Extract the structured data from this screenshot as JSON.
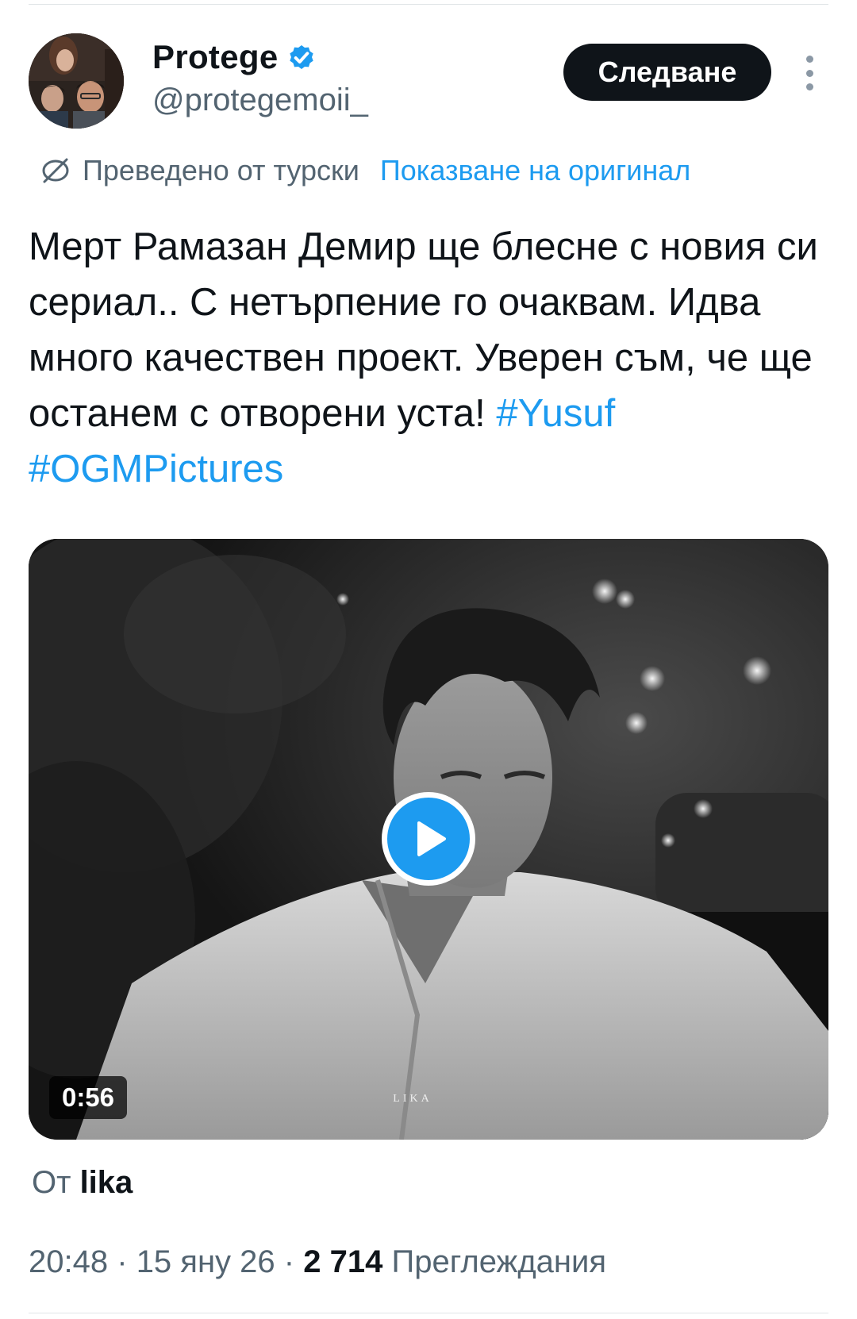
{
  "author": {
    "display_name": "Protege",
    "handle": "@protegemoii_",
    "verified": true,
    "follow_label": "Следване"
  },
  "translation": {
    "label": "Преведено от турски",
    "show_original_label": "Показване на оригинал"
  },
  "tweet": {
    "text": "Мерт Рамазан Демир ще блесне с новия си сериал.. С нетърпение го очаквам. Идва много качествен проект. Уверен съм, че ще останем с отворени уста!",
    "hashtags": [
      "#Yusuf",
      "#OGMPictures"
    ]
  },
  "media": {
    "duration": "0:56",
    "watermark": "LIKA"
  },
  "attribution": {
    "prefix": "От",
    "source": "lika"
  },
  "meta": {
    "time": "20:48",
    "separator": "·",
    "date": "15 яну 26",
    "views_count": "2 714",
    "views_label": "Преглеждания"
  },
  "colors": {
    "accent": "#1d9bf0",
    "text": "#0f1419",
    "secondary_text": "#536471",
    "follow_button_bg": "#0f1419"
  },
  "icons": [
    "verified-badge-icon",
    "globe-slash-icon",
    "more-vertical-icon",
    "play-icon"
  ]
}
